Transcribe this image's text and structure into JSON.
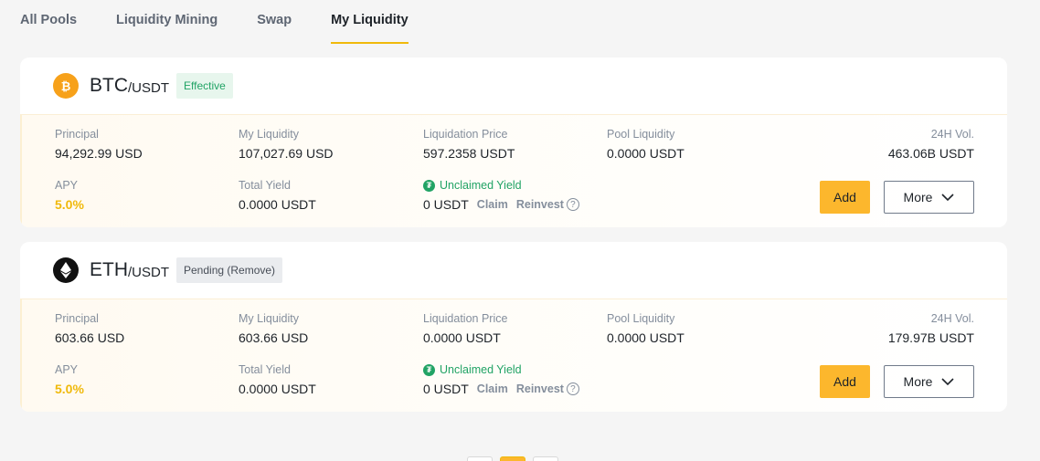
{
  "tabs": [
    {
      "label": "All Pools",
      "active": false
    },
    {
      "label": "Liquidity Mining",
      "active": false
    },
    {
      "label": "Swap",
      "active": false
    },
    {
      "label": "My Liquidity",
      "active": true
    }
  ],
  "pools": [
    {
      "coin_icon": "btc-coin-icon",
      "base": "BTC",
      "quote": "/USDT",
      "status": "Effective",
      "principal_label": "Principal",
      "principal": "94,292.99 USD",
      "my_liquidity_label": "My Liquidity",
      "my_liquidity": "107,027.69 USD",
      "liq_price_label": "Liquidation Price",
      "liq_price": "597.2358 USDT",
      "pool_liq_label": "Pool Liquidity",
      "pool_liq": "0.0000 USDT",
      "vol_label": "24H Vol.",
      "vol": "463.06B USDT",
      "apy_label": "APY",
      "apy": "5.0%",
      "total_yield_label": "Total Yield",
      "total_yield": "0.0000 USDT",
      "unclaimed_label": "Unclaimed Yield",
      "unclaimed": "0 USDT",
      "claim": "Claim",
      "reinvest": "Reinvest",
      "add": "Add",
      "more": "More"
    },
    {
      "coin_icon": "eth-coin-icon",
      "base": "ETH",
      "quote": "/USDT",
      "status": "Pending (Remove)",
      "principal_label": "Principal",
      "principal": "603.66 USD",
      "my_liquidity_label": "My Liquidity",
      "my_liquidity": "603.66 USD",
      "liq_price_label": "Liquidation Price",
      "liq_price": "0.0000 USDT",
      "pool_liq_label": "Pool Liquidity",
      "pool_liq": "0.0000 USDT",
      "vol_label": "24H Vol.",
      "vol": "179.97B USDT",
      "apy_label": "APY",
      "apy": "5.0%",
      "total_yield_label": "Total Yield",
      "total_yield": "0.0000 USDT",
      "unclaimed_label": "Unclaimed Yield",
      "unclaimed": "0 USDT",
      "claim": "Claim",
      "reinvest": "Reinvest",
      "add": "Add",
      "more": "More"
    }
  ],
  "colors": {
    "accent": "#f0b90b",
    "green": "#21a365"
  }
}
